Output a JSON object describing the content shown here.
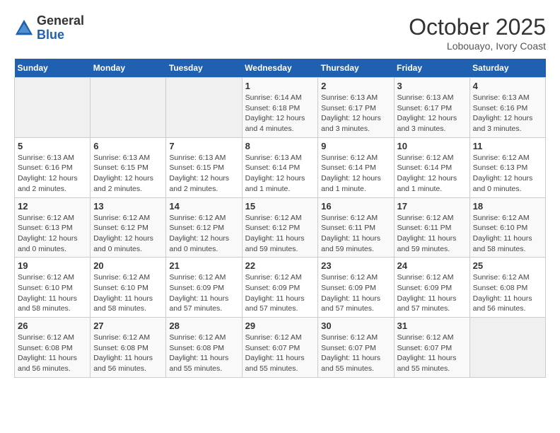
{
  "header": {
    "logo_general": "General",
    "logo_blue": "Blue",
    "month": "October 2025",
    "location": "Lobouayo, Ivory Coast"
  },
  "days_of_week": [
    "Sunday",
    "Monday",
    "Tuesday",
    "Wednesday",
    "Thursday",
    "Friday",
    "Saturday"
  ],
  "weeks": [
    [
      {
        "day": "",
        "info": ""
      },
      {
        "day": "",
        "info": ""
      },
      {
        "day": "",
        "info": ""
      },
      {
        "day": "1",
        "info": "Sunrise: 6:14 AM\nSunset: 6:18 PM\nDaylight: 12 hours and 4 minutes."
      },
      {
        "day": "2",
        "info": "Sunrise: 6:13 AM\nSunset: 6:17 PM\nDaylight: 12 hours and 3 minutes."
      },
      {
        "day": "3",
        "info": "Sunrise: 6:13 AM\nSunset: 6:17 PM\nDaylight: 12 hours and 3 minutes."
      },
      {
        "day": "4",
        "info": "Sunrise: 6:13 AM\nSunset: 6:16 PM\nDaylight: 12 hours and 3 minutes."
      }
    ],
    [
      {
        "day": "5",
        "info": "Sunrise: 6:13 AM\nSunset: 6:16 PM\nDaylight: 12 hours and 2 minutes."
      },
      {
        "day": "6",
        "info": "Sunrise: 6:13 AM\nSunset: 6:15 PM\nDaylight: 12 hours and 2 minutes."
      },
      {
        "day": "7",
        "info": "Sunrise: 6:13 AM\nSunset: 6:15 PM\nDaylight: 12 hours and 2 minutes."
      },
      {
        "day": "8",
        "info": "Sunrise: 6:13 AM\nSunset: 6:14 PM\nDaylight: 12 hours and 1 minute."
      },
      {
        "day": "9",
        "info": "Sunrise: 6:12 AM\nSunset: 6:14 PM\nDaylight: 12 hours and 1 minute."
      },
      {
        "day": "10",
        "info": "Sunrise: 6:12 AM\nSunset: 6:14 PM\nDaylight: 12 hours and 1 minute."
      },
      {
        "day": "11",
        "info": "Sunrise: 6:12 AM\nSunset: 6:13 PM\nDaylight: 12 hours and 0 minutes."
      }
    ],
    [
      {
        "day": "12",
        "info": "Sunrise: 6:12 AM\nSunset: 6:13 PM\nDaylight: 12 hours and 0 minutes."
      },
      {
        "day": "13",
        "info": "Sunrise: 6:12 AM\nSunset: 6:12 PM\nDaylight: 12 hours and 0 minutes."
      },
      {
        "day": "14",
        "info": "Sunrise: 6:12 AM\nSunset: 6:12 PM\nDaylight: 12 hours and 0 minutes."
      },
      {
        "day": "15",
        "info": "Sunrise: 6:12 AM\nSunset: 6:12 PM\nDaylight: 11 hours and 59 minutes."
      },
      {
        "day": "16",
        "info": "Sunrise: 6:12 AM\nSunset: 6:11 PM\nDaylight: 11 hours and 59 minutes."
      },
      {
        "day": "17",
        "info": "Sunrise: 6:12 AM\nSunset: 6:11 PM\nDaylight: 11 hours and 59 minutes."
      },
      {
        "day": "18",
        "info": "Sunrise: 6:12 AM\nSunset: 6:10 PM\nDaylight: 11 hours and 58 minutes."
      }
    ],
    [
      {
        "day": "19",
        "info": "Sunrise: 6:12 AM\nSunset: 6:10 PM\nDaylight: 11 hours and 58 minutes."
      },
      {
        "day": "20",
        "info": "Sunrise: 6:12 AM\nSunset: 6:10 PM\nDaylight: 11 hours and 58 minutes."
      },
      {
        "day": "21",
        "info": "Sunrise: 6:12 AM\nSunset: 6:09 PM\nDaylight: 11 hours and 57 minutes."
      },
      {
        "day": "22",
        "info": "Sunrise: 6:12 AM\nSunset: 6:09 PM\nDaylight: 11 hours and 57 minutes."
      },
      {
        "day": "23",
        "info": "Sunrise: 6:12 AM\nSunset: 6:09 PM\nDaylight: 11 hours and 57 minutes."
      },
      {
        "day": "24",
        "info": "Sunrise: 6:12 AM\nSunset: 6:09 PM\nDaylight: 11 hours and 57 minutes."
      },
      {
        "day": "25",
        "info": "Sunrise: 6:12 AM\nSunset: 6:08 PM\nDaylight: 11 hours and 56 minutes."
      }
    ],
    [
      {
        "day": "26",
        "info": "Sunrise: 6:12 AM\nSunset: 6:08 PM\nDaylight: 11 hours and 56 minutes."
      },
      {
        "day": "27",
        "info": "Sunrise: 6:12 AM\nSunset: 6:08 PM\nDaylight: 11 hours and 56 minutes."
      },
      {
        "day": "28",
        "info": "Sunrise: 6:12 AM\nSunset: 6:08 PM\nDaylight: 11 hours and 55 minutes."
      },
      {
        "day": "29",
        "info": "Sunrise: 6:12 AM\nSunset: 6:07 PM\nDaylight: 11 hours and 55 minutes."
      },
      {
        "day": "30",
        "info": "Sunrise: 6:12 AM\nSunset: 6:07 PM\nDaylight: 11 hours and 55 minutes."
      },
      {
        "day": "31",
        "info": "Sunrise: 6:12 AM\nSunset: 6:07 PM\nDaylight: 11 hours and 55 minutes."
      },
      {
        "day": "",
        "info": ""
      }
    ]
  ]
}
